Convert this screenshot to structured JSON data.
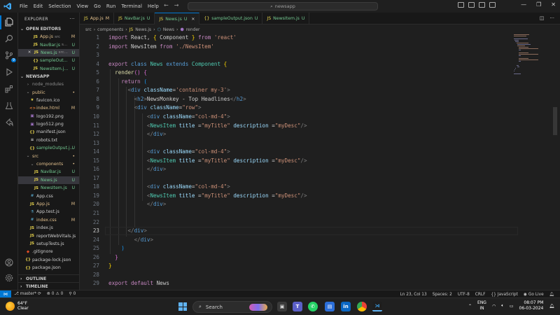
{
  "titlebar": {
    "menu": [
      "File",
      "Edit",
      "Selection",
      "View",
      "Go",
      "Run",
      "Terminal",
      "Help"
    ],
    "search_text": "newsapp"
  },
  "sidebar": {
    "title": "EXPLORER",
    "open_editors_label": "OPEN EDITORS",
    "open_editors": [
      {
        "icon": "JS",
        "name": "App.js",
        "path": "src",
        "status": "M"
      },
      {
        "icon": "JS",
        "name": "NavBar.js",
        "path": "s...",
        "status": "U"
      },
      {
        "icon": "JS",
        "name": "News.js",
        "path": "src...",
        "status": "U",
        "selected": true,
        "close": true
      },
      {
        "icon": "{}",
        "name": "sampleOut...",
        "path": "",
        "status": "U"
      },
      {
        "icon": "JS",
        "name": "NewsItem.j...",
        "path": "",
        "status": "U"
      }
    ],
    "project_label": "NEWSAPP",
    "tree": [
      {
        "depth": 1,
        "kind": "folder",
        "name": "node_modules",
        "dim": true
      },
      {
        "depth": 1,
        "kind": "folder",
        "name": "public",
        "status": "•",
        "open": true
      },
      {
        "depth": 2,
        "icon": "★",
        "name": "favicon.ico"
      },
      {
        "depth": 2,
        "icon": "<>",
        "name": "index.html",
        "status": "M"
      },
      {
        "depth": 2,
        "icon": "▣",
        "name": "logo192.png"
      },
      {
        "depth": 2,
        "icon": "▣",
        "name": "logo512.png"
      },
      {
        "depth": 2,
        "icon": "{}",
        "name": "manifest.json"
      },
      {
        "depth": 2,
        "icon": "≡",
        "name": "robots.txt"
      },
      {
        "depth": 2,
        "icon": "{}",
        "name": "sampleOutput.j...",
        "status": "U"
      },
      {
        "depth": 1,
        "kind": "folder",
        "name": "src",
        "status": "•",
        "open": true
      },
      {
        "depth": 2,
        "kind": "folder",
        "name": "components",
        "status": "•",
        "open": true
      },
      {
        "depth": 3,
        "icon": "JS",
        "name": "NavBar.js",
        "status": "U"
      },
      {
        "depth": 3,
        "icon": "JS",
        "name": "News.js",
        "status": "U",
        "selected": true
      },
      {
        "depth": 3,
        "icon": "JS",
        "name": "NewsItem.js",
        "status": "U"
      },
      {
        "depth": 2,
        "icon": "#",
        "name": "App.css"
      },
      {
        "depth": 2,
        "icon": "JS",
        "name": "App.js",
        "status": "M"
      },
      {
        "depth": 2,
        "icon": "⚗",
        "name": "App.test.js"
      },
      {
        "depth": 2,
        "icon": "#",
        "name": "index.css",
        "status": "M"
      },
      {
        "depth": 2,
        "icon": "JS",
        "name": "index.js"
      },
      {
        "depth": 2,
        "icon": "JS",
        "name": "reportWebVitals.js"
      },
      {
        "depth": 2,
        "icon": "JS",
        "name": "setupTests.js"
      },
      {
        "depth": 1,
        "icon": "◆",
        "name": ".gitignore"
      },
      {
        "depth": 1,
        "icon": "{}",
        "name": "package-lock.json"
      },
      {
        "depth": 1,
        "icon": "{}",
        "name": "package.json"
      }
    ],
    "outline_label": "OUTLINE",
    "timeline_label": "TIMELINE"
  },
  "tabs": [
    {
      "icon": "JS",
      "name": "App.js",
      "status": "M"
    },
    {
      "icon": "JS",
      "name": "NavBar.js",
      "status": "U"
    },
    {
      "icon": "JS",
      "name": "News.js",
      "status": "U",
      "active": true
    },
    {
      "icon": "{}",
      "name": "sampleOutput.json",
      "status": "U"
    },
    {
      "icon": "JS",
      "name": "NewsItem.js",
      "status": "U"
    }
  ],
  "breadcrumb": [
    "src",
    "components",
    "News.js",
    "News",
    "render"
  ],
  "editor": {
    "current_line": 23,
    "lines": [
      [
        [
          "kw",
          "import"
        ],
        [
          "txt",
          " React, "
        ],
        [
          "br1",
          "{"
        ],
        [
          "txt",
          " Component "
        ],
        [
          "br1",
          "}"
        ],
        [
          "txt",
          " "
        ],
        [
          "kw",
          "from"
        ],
        [
          "txt",
          " "
        ],
        [
          "str",
          "'react'"
        ]
      ],
      [
        [
          "kw",
          "import"
        ],
        [
          "txt",
          " NewsItem "
        ],
        [
          "kw",
          "from"
        ],
        [
          "txt",
          " "
        ],
        [
          "str",
          "'./NewsItem'"
        ]
      ],
      [],
      [
        [
          "kw",
          "export"
        ],
        [
          "txt",
          " "
        ],
        [
          "kb",
          "class"
        ],
        [
          "txt",
          " "
        ],
        [
          "cls",
          "News"
        ],
        [
          "txt",
          " "
        ],
        [
          "kb",
          "extends"
        ],
        [
          "txt",
          " "
        ],
        [
          "cls",
          "Component"
        ],
        [
          "txt",
          " "
        ],
        [
          "br1",
          "{"
        ]
      ],
      [
        [
          "txt",
          "  "
        ],
        [
          "fn",
          "render"
        ],
        [
          "br2",
          "()"
        ],
        [
          "txt",
          " "
        ],
        [
          "br2",
          "{"
        ]
      ],
      [
        [
          "txt",
          "    "
        ],
        [
          "kw",
          "return"
        ],
        [
          "txt",
          " "
        ],
        [
          "br3",
          "("
        ]
      ],
      [
        [
          "txt",
          "      "
        ],
        [
          "brk",
          "<"
        ],
        [
          "tag",
          "div"
        ],
        [
          "txt",
          " "
        ],
        [
          "attr",
          "className"
        ],
        [
          "txt",
          "="
        ],
        [
          "str",
          "'container my-3'"
        ],
        [
          "brk",
          ">"
        ]
      ],
      [
        [
          "txt",
          "        "
        ],
        [
          "brk",
          "<"
        ],
        [
          "tag",
          "h2"
        ],
        [
          "brk",
          ">"
        ],
        [
          "txt",
          "NewsMonkey - Top Headlines"
        ],
        [
          "brk",
          "</"
        ],
        [
          "tag",
          "h2"
        ],
        [
          "brk",
          ">"
        ]
      ],
      [
        [
          "txt",
          "        "
        ],
        [
          "brk",
          "<"
        ],
        [
          "tag",
          "div"
        ],
        [
          "txt",
          " "
        ],
        [
          "attr",
          "className"
        ],
        [
          "txt",
          "="
        ],
        [
          "str",
          "\"row\""
        ],
        [
          "brk",
          ">"
        ]
      ],
      [
        [
          "txt",
          "            "
        ],
        [
          "brk",
          "<"
        ],
        [
          "tag",
          "div"
        ],
        [
          "txt",
          " "
        ],
        [
          "attr",
          "className"
        ],
        [
          "txt",
          "="
        ],
        [
          "str",
          "\"col-md-4\""
        ],
        [
          "brk",
          ">"
        ]
      ],
      [
        [
          "txt",
          "            "
        ],
        [
          "brk",
          "<"
        ],
        [
          "cls",
          "NewsItem"
        ],
        [
          "txt",
          " "
        ],
        [
          "attr",
          "title"
        ],
        [
          "txt",
          " ="
        ],
        [
          "str",
          "\"myTitle\""
        ],
        [
          "txt",
          " "
        ],
        [
          "attr",
          "description"
        ],
        [
          "txt",
          " ="
        ],
        [
          "str",
          "\"myDesc\""
        ],
        [
          "brk",
          "/>"
        ]
      ],
      [
        [
          "txt",
          "            "
        ],
        [
          "brk",
          "</"
        ],
        [
          "tag",
          "div"
        ],
        [
          "brk",
          ">"
        ]
      ],
      [],
      [
        [
          "txt",
          "            "
        ],
        [
          "brk",
          "<"
        ],
        [
          "tag",
          "div"
        ],
        [
          "txt",
          " "
        ],
        [
          "attr",
          "className"
        ],
        [
          "txt",
          "="
        ],
        [
          "str",
          "\"col-md-4\""
        ],
        [
          "brk",
          ">"
        ]
      ],
      [
        [
          "txt",
          "            "
        ],
        [
          "brk",
          "<"
        ],
        [
          "cls",
          "NewsItem"
        ],
        [
          "txt",
          " "
        ],
        [
          "attr",
          "title"
        ],
        [
          "txt",
          " ="
        ],
        [
          "str",
          "\"myTitle\""
        ],
        [
          "txt",
          " "
        ],
        [
          "attr",
          "description"
        ],
        [
          "txt",
          " ="
        ],
        [
          "str",
          "\"myDesc\""
        ],
        [
          "brk",
          "/>"
        ]
      ],
      [
        [
          "txt",
          "            "
        ],
        [
          "brk",
          "</"
        ],
        [
          "tag",
          "div"
        ],
        [
          "brk",
          ">"
        ]
      ],
      [],
      [
        [
          "txt",
          "            "
        ],
        [
          "brk",
          "<"
        ],
        [
          "tag",
          "div"
        ],
        [
          "txt",
          " "
        ],
        [
          "attr",
          "className"
        ],
        [
          "txt",
          "="
        ],
        [
          "str",
          "\"col-md-4\""
        ],
        [
          "brk",
          ">"
        ]
      ],
      [
        [
          "txt",
          "            "
        ],
        [
          "brk",
          "<"
        ],
        [
          "cls",
          "NewsItem"
        ],
        [
          "txt",
          " "
        ],
        [
          "attr",
          "title"
        ],
        [
          "txt",
          " ="
        ],
        [
          "str",
          "\"myTitle\""
        ],
        [
          "txt",
          " "
        ],
        [
          "attr",
          "description"
        ],
        [
          "txt",
          " ="
        ],
        [
          "str",
          "\"myDesc\""
        ],
        [
          "brk",
          "/>"
        ]
      ],
      [
        [
          "txt",
          "            "
        ],
        [
          "brk",
          "</"
        ],
        [
          "tag",
          "div"
        ],
        [
          "brk",
          ">"
        ]
      ],
      [],
      [],
      [
        [
          "txt",
          "      "
        ],
        [
          "brk",
          "</"
        ],
        [
          "tag",
          "div"
        ],
        [
          "brk",
          ">"
        ]
      ],
      [
        [
          "txt",
          "        "
        ],
        [
          "brk",
          "</"
        ],
        [
          "tag",
          "div"
        ],
        [
          "brk",
          ">"
        ]
      ],
      [
        [
          "txt",
          "    "
        ],
        [
          "br3",
          ")"
        ]
      ],
      [
        [
          "txt",
          "  "
        ],
        [
          "br2",
          "}"
        ]
      ],
      [
        [
          "br1",
          "}"
        ]
      ],
      [],
      [
        [
          "kw",
          "export"
        ],
        [
          "txt",
          " "
        ],
        [
          "kw",
          "default"
        ],
        [
          "txt",
          " News"
        ]
      ]
    ]
  },
  "statusbar": {
    "branch": "master*",
    "errors": "0",
    "warnings": "0",
    "ports": "0",
    "position": "Ln 23, Col 13",
    "spaces": "Spaces: 2",
    "encoding": "UTF-8",
    "eol": "CRLF",
    "language": "JavaScript",
    "golive": "Go Live"
  },
  "taskbar": {
    "temp": "64°F",
    "condition": "Clear",
    "search": "Search",
    "lang1": "ENG",
    "lang2": "IN",
    "time": "08:07 PM",
    "date": "06-03-2024"
  },
  "colors": {
    "accent": "#0078d4",
    "modified": "#e2c08d",
    "untracked": "#73c991"
  }
}
